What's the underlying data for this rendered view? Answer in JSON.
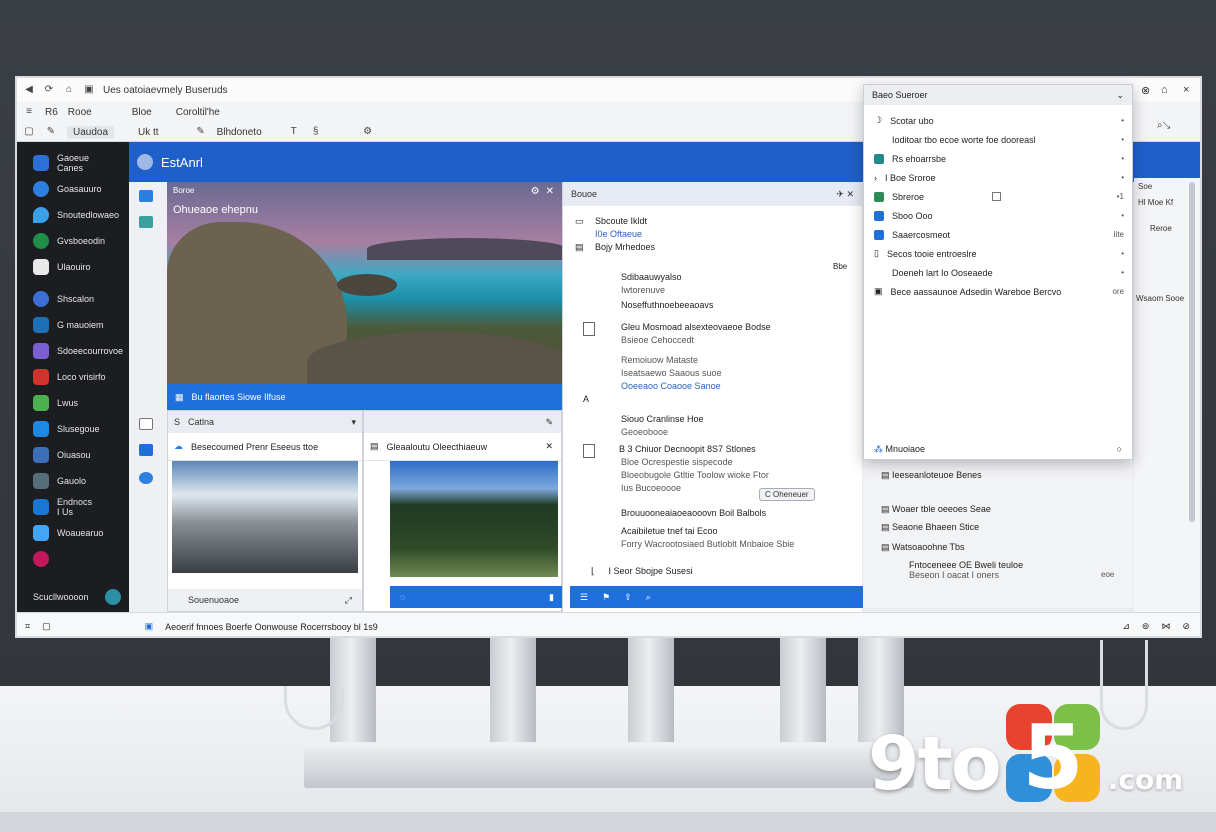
{
  "titlebar": {
    "title": "Ues oatoiaevmely Buseruds"
  },
  "toolbar": {
    "row1": [
      "R6",
      "Rooe",
      "Bloe",
      "Coroltil'he"
    ],
    "row2": [
      "Uaudoa",
      "Uk tt",
      "Blhdoneto"
    ]
  },
  "sidebar": {
    "items": [
      {
        "label": "Gaoeue",
        "sub": "Canes",
        "color": "#2c6fd6"
      },
      {
        "label": "Goasauuro",
        "color": "#2a7fe0"
      },
      {
        "label": "Snoutedlowaeo",
        "color": "#3aa0e8"
      },
      {
        "label": "Gvsboeodin",
        "color": "#1f8f4a"
      },
      {
        "label": "Ulaouiro",
        "color": "#e9e9e9"
      },
      {
        "label": "Shscalon",
        "color": "#3b6fd6"
      },
      {
        "label": "G mauoiem",
        "color": "#1f6fb4"
      },
      {
        "label": "Sdoeecourrovoe",
        "color": "#7a5fd0"
      },
      {
        "label": "Loco vrisirfo",
        "color": "#d0342c"
      },
      {
        "label": "Lwus",
        "color": "#4caf50"
      },
      {
        "label": "Slusegoue",
        "color": "#1e88e5"
      },
      {
        "label": "Oiuasou",
        "color": "#3d6fb8"
      },
      {
        "label": "Gauolo",
        "color": "#546e7a"
      },
      {
        "label": "Endnocs",
        "sub": "I Us",
        "color": "#1976d2"
      },
      {
        "label": "Woauearuo",
        "color": "#42a5f5"
      },
      {
        "label": "",
        "color": "#c2185b"
      }
    ],
    "bottom_label": "Scucllwoooon"
  },
  "banner": {
    "title": "EstAnrl"
  },
  "photo": {
    "caption": "Ohueaoe ehepnu",
    "top_left": "Boroe",
    "bar_text": "Bu flaortes Siowe Ilfuse"
  },
  "win_left": {
    "head": "Catlna",
    "sub": "Besecoumed Prenr Eseeus ttoe",
    "foot": "Souenuoaoe"
  },
  "win_mid": {
    "sub": "Gleaaloutu Oleecthiaeuw"
  },
  "detail": {
    "head": "Bouoe",
    "rows": [
      {
        "t1": "Sbcoute Ikldt",
        "t2": "I0e Oftaeue"
      },
      {
        "t1": "Bojy Mrhedoes",
        "side": "Bbe"
      },
      {
        "t1": "Sdibaauwyalso",
        "t2": "Iwtorenuve"
      },
      {
        "t1": "Noseffuthnoebeeaoavs"
      },
      {
        "t1": "Gleu Mosmoad alsexteovaeoe Bodse",
        "t2": "Bsieoe Cehoccedt",
        "t3": "Remoiuow Mataste",
        "t4": "Iseatsaewo Saaous suoe",
        "t5": "Ooeeaoo Coaooe Sanoe"
      },
      {
        "t1": "Siouo Cranlinse Hoe",
        "t2": "Geoeobooe"
      },
      {
        "t1": "B 3 Chiuor Decnoopit 8S7 Stlones",
        "t2": "Bloe Ocrespestie sispecode",
        "t3": "Bloeobugole Gtltie Toolow wioke Ftor",
        "t4": "Ius Bucoeoooe",
        "pill": "C Oheneuer"
      },
      {
        "t1": "Brouuooneaiaoeaooovn Boil Balbols"
      },
      {
        "t1": "Acaibiletue tnef tai Ecoo",
        "t2": "Forry Wacrootosiaed Butloblt Mnbaioe Sbie"
      },
      {
        "t1": "I Seor Sbojpe Susesi"
      }
    ]
  },
  "popup": {
    "head": "Baeo Sueroer",
    "rows": [
      {
        "label": "Scotar ubo",
        "value": "•"
      },
      {
        "label": "Ioditoar tbo ecoe worte foe dooreasl",
        "value": "•"
      },
      {
        "label": "Rs ehoarrsbe",
        "value": "•"
      },
      {
        "label": "I Boe Sroroe",
        "value": "•"
      },
      {
        "label": "Sbreroe",
        "value": "•1"
      },
      {
        "label": "Sboo Ooo",
        "value": "•"
      },
      {
        "label": "Saaercosmeot",
        "value": "lite"
      },
      {
        "label": "Secos tooie entroeslre",
        "value": "•"
      },
      {
        "label": "Doeneh lart Io Ooseaede",
        "value": "•"
      },
      {
        "label": "Bece aassaunoe Adsedin Wareboe Bercvo",
        "value": "ore"
      }
    ],
    "foot": "Mnuoiaoe"
  },
  "rightpane": {
    "r1": "Soe",
    "r2": "Hl Moe Kf",
    "r3": "Reroe",
    "r4": "Wsaom Sooe"
  },
  "lower_list": {
    "rows": [
      {
        "label": "Ieeseanloteuoe Benes"
      },
      {
        "label": "Woaer tble oeeoes Seae"
      },
      {
        "label": "Seaone Bhaeen Stice"
      },
      {
        "label": "Watsoaoohne Tbs"
      },
      {
        "label": "Fntoceneee OE Bweli teuloe",
        "sub": "Beseon I oacat I oners",
        "value": "eoe"
      }
    ]
  },
  "taskbar": {
    "text": "Aeoerif fnnoes Boerfe Oonwouse Rocerrsbooy bl 1s9"
  },
  "logo": {
    "main": "9to",
    "five": "5",
    "tld": ".com"
  }
}
